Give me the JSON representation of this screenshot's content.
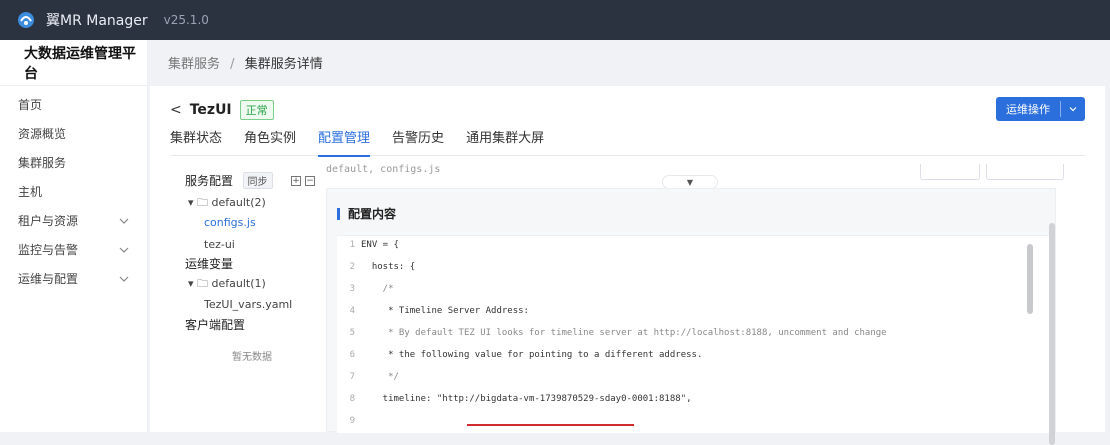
{
  "app": {
    "name": "翼MR Manager",
    "version": "v25.1.0"
  },
  "sidebar": {
    "platform_title": "大数据运维管理平台",
    "items": [
      {
        "label": "首页",
        "expandable": false
      },
      {
        "label": "资源概览",
        "expandable": false
      },
      {
        "label": "集群服务",
        "expandable": false
      },
      {
        "label": "主机",
        "expandable": false
      },
      {
        "label": "租户与资源",
        "expandable": true
      },
      {
        "label": "监控与告警",
        "expandable": true
      },
      {
        "label": "运维与配置",
        "expandable": true
      }
    ],
    "collapse_glyph": "‹"
  },
  "breadcrumb": {
    "parent": "集群服务",
    "sep": "/",
    "current": "集群服务详情"
  },
  "header": {
    "back_glyph": "<",
    "service_name": "TezUI",
    "status": "正常",
    "ops_button": "运维操作"
  },
  "tabs": [
    {
      "label": "集群状态",
      "active": false
    },
    {
      "label": "角色实例",
      "active": false
    },
    {
      "label": "配置管理",
      "active": true
    },
    {
      "label": "告警历史",
      "active": false
    },
    {
      "label": "通用集群大屏",
      "active": false
    }
  ],
  "tree": {
    "service_config": "服务配置",
    "sync": "同步",
    "default_group": "default(2)",
    "file_active": "configs.js",
    "file_2": "tez-ui",
    "ops_vars": "运维变量",
    "default_group_2": "default(1)",
    "file_3": "TezUI_vars.yaml",
    "client_config": "客户端配置",
    "empty_text": "暂无数据"
  },
  "editor": {
    "top_text": "default, configs.js",
    "panel_title": "配置内容",
    "lines": [
      {
        "n": "1",
        "text": "ENV = {",
        "comment": false
      },
      {
        "n": "2",
        "text": "  hosts: {",
        "comment": false
      },
      {
        "n": "3",
        "text": "    /*",
        "comment": true
      },
      {
        "n": "4",
        "text": "     * Timeline Server Address:",
        "comment": false
      },
      {
        "n": "5",
        "text": "     * By default TEZ UI looks for timeline server at http://localhost:8188, uncomment and change",
        "comment": true
      },
      {
        "n": "6",
        "text": "     * the following value for pointing to a different address.",
        "comment": false
      },
      {
        "n": "7",
        "text": "     */",
        "comment": true
      },
      {
        "n": "8",
        "text": "    timeline: \"http://bigdata-vm-1739870529-sday0-0001:8188\",",
        "comment": false
      },
      {
        "n": "9",
        "text": "",
        "comment": false
      }
    ]
  },
  "colors": {
    "accent": "#2b6fdd",
    "success": "#2ca24a",
    "topbar": "#2b3240",
    "annotation": "#d12b2b"
  }
}
